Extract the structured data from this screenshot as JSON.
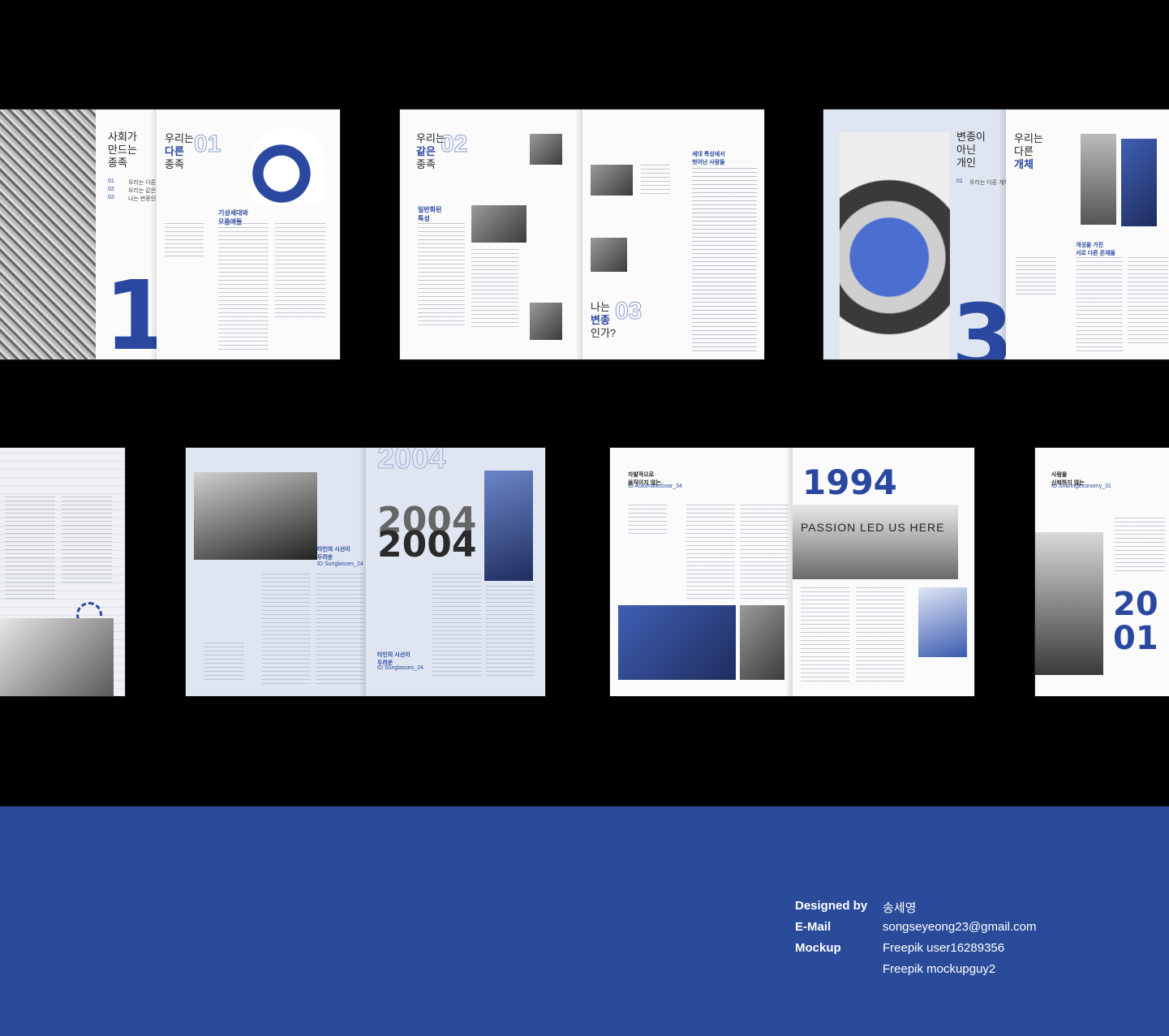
{
  "spreads": {
    "s1": {
      "left_title": "사회가\n만드는\n종족",
      "toc": [
        {
          "num": "01",
          "label": "우리는 다른 종족"
        },
        {
          "num": "02",
          "label": "우리는 같은 종족"
        },
        {
          "num": "03",
          "label": "나는 변종인가"
        }
      ],
      "big_number": "1",
      "right_title_a": "우리는",
      "right_title_b": "다른",
      "right_title_c": "종족",
      "outline_num": "01",
      "subhead": "기성세대와\n요즘애들"
    },
    "s2": {
      "title_a": "우리는",
      "title_b": "같은",
      "title_c": "종족",
      "outline_num": "02",
      "subhead": "일반화된\n특성",
      "right_subhead": "세대 특성에서\n벗어난 사람들",
      "bottom_title_a": "나는",
      "bottom_title_b": "변종",
      "bottom_title_c": "인가?",
      "bottom_outline": "03"
    },
    "s3": {
      "left_title": "변종이\n아닌\n개인",
      "toc_num": "01",
      "toc_label": "우리는 다른 개체",
      "big_number": "3",
      "right_title_a": "우리는",
      "right_title_b": "다른",
      "right_title_c": "개체",
      "subhead": "개성을 가진\n서로 다른 존재들"
    },
    "s5": {
      "watermark": "2004",
      "big_year_a": "2004",
      "big_year_b": "2004",
      "caption_a": "타인의 시선이\n두려운",
      "caption_a_id": "ID Sunglasses_24",
      "caption_b": "타인의 시선이\n두려운",
      "caption_b_id": "ID Sunglasses_24"
    },
    "s6": {
      "subhead": "자발적으로\n움직이지 않는",
      "subhead_id": "ID AutomaticGear_34",
      "year": "1994",
      "photo_text": "PASSION LED US HERE"
    },
    "s7": {
      "subhead": "사람을\n신뢰하지 않는",
      "subhead_id": "ID SharingEconomy_31",
      "year_a": "20",
      "year_b": "01"
    }
  },
  "credits": [
    {
      "label": "Designed by",
      "value": "송세영"
    },
    {
      "label": "E-Mail",
      "value": "songseyeong23@gmail.com"
    },
    {
      "label": "Mockup",
      "value": "Freepik user16289356"
    },
    {
      "label": "",
      "value": "Freepik mockupguy2"
    }
  ],
  "colors": {
    "accent": "#2a4b9a",
    "background": "#000000",
    "page": "#fbfbfc",
    "page_blue": "#dfe6f1"
  }
}
